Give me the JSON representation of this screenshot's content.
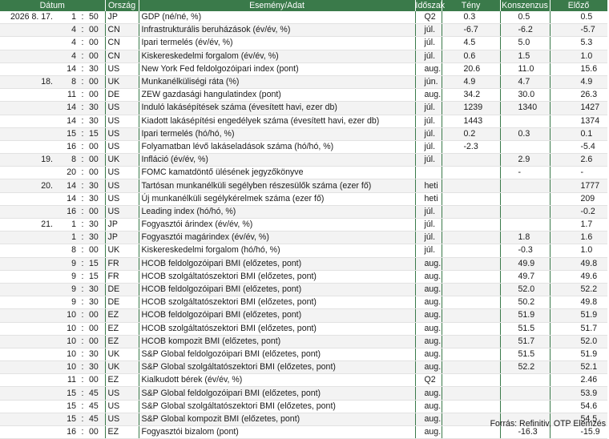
{
  "header": {
    "date": "Dátum",
    "country": "Ország",
    "event": "Esemény/Adat",
    "period": "Időszak",
    "actual": "Tény",
    "consensus": "Konszenzus",
    "previous": "Előző"
  },
  "rows": [
    {
      "date": "2026  8.  17.",
      "h": "1",
      "m": "50",
      "country": "JP",
      "event": "GDP (né/né, %)",
      "period": "Q2",
      "actual": "0.3",
      "consensus": "0.5",
      "previous": "0.5"
    },
    {
      "date": "",
      "h": "4",
      "m": "00",
      "country": "CN",
      "event": "Infrastrukturális beruházások (év/év, %)",
      "period": "júl.",
      "actual": "-6.7",
      "consensus": "-6.2",
      "previous": "-5.7"
    },
    {
      "date": "",
      "h": "4",
      "m": "00",
      "country": "CN",
      "event": "Ipari termelés (év/év, %)",
      "period": "júl.",
      "actual": "4.5",
      "consensus": "5.0",
      "previous": "5.3"
    },
    {
      "date": "",
      "h": "4",
      "m": "00",
      "country": "CN",
      "event": "Kiskereskedelmi forgalom (év/év, %)",
      "period": "júl.",
      "actual": "0.6",
      "consensus": "1.5",
      "previous": "1.0"
    },
    {
      "date": "",
      "h": "14",
      "m": "30",
      "country": "US",
      "event": "New York Fed feldolgozóipari index (pont)",
      "period": "aug.",
      "actual": "20.6",
      "consensus": "11.0",
      "previous": "15.6"
    },
    {
      "date": "18.",
      "h": "8",
      "m": "00",
      "country": "UK",
      "event": "Munkanélküliségi ráta (%)",
      "period": "jún.",
      "actual": "4.9",
      "consensus": "4.7",
      "previous": "4.9"
    },
    {
      "date": "",
      "h": "11",
      "m": "00",
      "country": "DE",
      "event": "ZEW gazdasági hangulatindex (pont)",
      "period": "aug.",
      "actual": "34.2",
      "consensus": "30.0",
      "previous": "26.3"
    },
    {
      "date": "",
      "h": "14",
      "m": "30",
      "country": "US",
      "event": "Induló lakásépítések száma (évesített havi, ezer db)",
      "period": "júl.",
      "actual": "1239",
      "consensus": "1340",
      "previous": "1427"
    },
    {
      "date": "",
      "h": "14",
      "m": "30",
      "country": "US",
      "event": "Kiadott lakásépítési engedélyek száma (évesített havi, ezer db)",
      "period": "júl.",
      "actual": "1443",
      "consensus": "",
      "previous": "1374"
    },
    {
      "date": "",
      "h": "15",
      "m": "15",
      "country": "US",
      "event": "Ipari termelés (hó/hó, %)",
      "period": "júl.",
      "actual": "0.2",
      "consensus": "0.3",
      "previous": "0.1"
    },
    {
      "date": "",
      "h": "16",
      "m": "00",
      "country": "US",
      "event": "Folyamatban lévő lakáseladások száma (hó/hó, %)",
      "period": "júl.",
      "actual": "-2.3",
      "consensus": "",
      "previous": "-5.4"
    },
    {
      "date": "19.",
      "h": "8",
      "m": "00",
      "country": "UK",
      "event": "Infláció (év/év, %)",
      "period": "júl.",
      "actual": "",
      "consensus": "2.9",
      "previous": "2.6"
    },
    {
      "date": "",
      "h": "20",
      "m": "00",
      "country": "US",
      "event": "FOMC kamatdöntő ülésének jegyzőkönyve",
      "period": "",
      "actual": "",
      "consensus": "-",
      "previous": "-"
    },
    {
      "date": "20.",
      "h": "14",
      "m": "30",
      "country": "US",
      "event": "Tartósan munkanélküli segélyben részesülők száma (ezer fő)",
      "period": "heti",
      "actual": "",
      "consensus": "",
      "previous": "1777"
    },
    {
      "date": "",
      "h": "14",
      "m": "30",
      "country": "US",
      "event": "Új munkanélküli segélykérelmek száma (ezer fő)",
      "period": "heti",
      "actual": "",
      "consensus": "",
      "previous": "209"
    },
    {
      "date": "",
      "h": "16",
      "m": "00",
      "country": "US",
      "event": "Leading index (hó/hó, %)",
      "period": "júl.",
      "actual": "",
      "consensus": "",
      "previous": "-0.2"
    },
    {
      "date": "21.",
      "h": "1",
      "m": "30",
      "country": "JP",
      "event": "Fogyasztói árindex (év/év, %)",
      "period": "júl.",
      "actual": "",
      "consensus": "",
      "previous": "1.7"
    },
    {
      "date": "",
      "h": "1",
      "m": "30",
      "country": "JP",
      "event": "Fogyasztói magárindex (év/év, %)",
      "period": "júl.",
      "actual": "",
      "consensus": "1.8",
      "previous": "1.6"
    },
    {
      "date": "",
      "h": "8",
      "m": "00",
      "country": "UK",
      "event": "Kiskereskedelmi forgalom (hó/hó, %)",
      "period": "júl.",
      "actual": "",
      "consensus": "-0.3",
      "previous": "1.0"
    },
    {
      "date": "",
      "h": "9",
      "m": "15",
      "country": "FR",
      "event": "HCOB feldolgozóipari BMI (előzetes, pont)",
      "period": "aug.",
      "actual": "",
      "consensus": "49.9",
      "previous": "49.8"
    },
    {
      "date": "",
      "h": "9",
      "m": "15",
      "country": "FR",
      "event": "HCOB szolgáltatószektori BMI (előzetes, pont)",
      "period": "aug.",
      "actual": "",
      "consensus": "49.7",
      "previous": "49.6"
    },
    {
      "date": "",
      "h": "9",
      "m": "30",
      "country": "DE",
      "event": "HCOB feldolgozóipari BMI (előzetes, pont)",
      "period": "aug.",
      "actual": "",
      "consensus": "52.0",
      "previous": "52.2"
    },
    {
      "date": "",
      "h": "9",
      "m": "30",
      "country": "DE",
      "event": "HCOB szolgáltatószektori BMI (előzetes, pont)",
      "period": "aug.",
      "actual": "",
      "consensus": "50.2",
      "previous": "49.8"
    },
    {
      "date": "",
      "h": "10",
      "m": "00",
      "country": "EZ",
      "event": "HCOB feldolgozóipari BMI (előzetes, pont)",
      "period": "aug.",
      "actual": "",
      "consensus": "51.9",
      "previous": "51.9"
    },
    {
      "date": "",
      "h": "10",
      "m": "00",
      "country": "EZ",
      "event": "HCOB szolgáltatószektori BMI (előzetes, pont)",
      "period": "aug.",
      "actual": "",
      "consensus": "51.5",
      "previous": "51.7"
    },
    {
      "date": "",
      "h": "10",
      "m": "00",
      "country": "EZ",
      "event": "HCOB kompozit BMI (előzetes, pont)",
      "period": "aug.",
      "actual": "",
      "consensus": "51.7",
      "previous": "52.0"
    },
    {
      "date": "",
      "h": "10",
      "m": "30",
      "country": "UK",
      "event": "S&P Global feldolgozóipari BMI (előzetes, pont)",
      "period": "aug.",
      "actual": "",
      "consensus": "51.5",
      "previous": "51.9"
    },
    {
      "date": "",
      "h": "10",
      "m": "30",
      "country": "UK",
      "event": "S&P Global szolgáltatószektori BMI (előzetes, pont)",
      "period": "aug.",
      "actual": "",
      "consensus": "52.2",
      "previous": "52.1"
    },
    {
      "date": "",
      "h": "11",
      "m": "00",
      "country": "EZ",
      "event": "Kialkudott bérek (év/év, %)",
      "period": "Q2",
      "actual": "",
      "consensus": "",
      "previous": "2.46"
    },
    {
      "date": "",
      "h": "15",
      "m": "45",
      "country": "US",
      "event": "S&P Global feldolgozóipari BMI (előzetes, pont)",
      "period": "aug.",
      "actual": "",
      "consensus": "",
      "previous": "53.9"
    },
    {
      "date": "",
      "h": "15",
      "m": "45",
      "country": "US",
      "event": "S&P Global szolgáltatószektori BMI (előzetes, pont)",
      "period": "aug.",
      "actual": "",
      "consensus": "",
      "previous": "54.6"
    },
    {
      "date": "",
      "h": "15",
      "m": "45",
      "country": "US",
      "event": "S&P Global kompozit BMI (előzetes, pont)",
      "period": "aug.",
      "actual": "",
      "consensus": "",
      "previous": "54.5"
    },
    {
      "date": "",
      "h": "16",
      "m": "00",
      "country": "EZ",
      "event": "Fogyasztói bizalom (pont)",
      "period": "aug.",
      "actual": "",
      "consensus": "-16.3",
      "previous": "-15.9"
    }
  ],
  "source": "Forrás: Refinitiv, OTP Elemzés"
}
